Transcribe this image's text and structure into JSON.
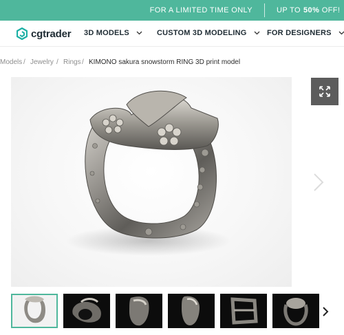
{
  "promo": {
    "limited_text": "FOR A LIMITED TIME ONLY",
    "deal_prefix": "UP TO",
    "deal_percent": "50%",
    "deal_suffix": "OFF!",
    "background": "#4fb79c"
  },
  "nav": {
    "logo_text": "cgtrader",
    "logo_icon": "cube-hexagon-icon",
    "items": [
      {
        "label": "3D MODELS"
      },
      {
        "label": "CUSTOM 3D MODELING"
      },
      {
        "label": "FOR DESIGNERS"
      }
    ]
  },
  "breadcrumb": {
    "items": [
      "Models",
      "Jewelry",
      "Rings"
    ],
    "separator": "/",
    "current": "KIMONO sakura snowstorm RING 3D print model"
  },
  "viewer": {
    "expand_icon": "expand-arrows-icon",
    "next_icon": "chevron-right-icon",
    "image_subject": "silver-ring-render"
  },
  "thumbnails": {
    "count": 6,
    "active_index": 0,
    "accent": "#4fb79c",
    "next_icon": "chevron-right-icon"
  }
}
